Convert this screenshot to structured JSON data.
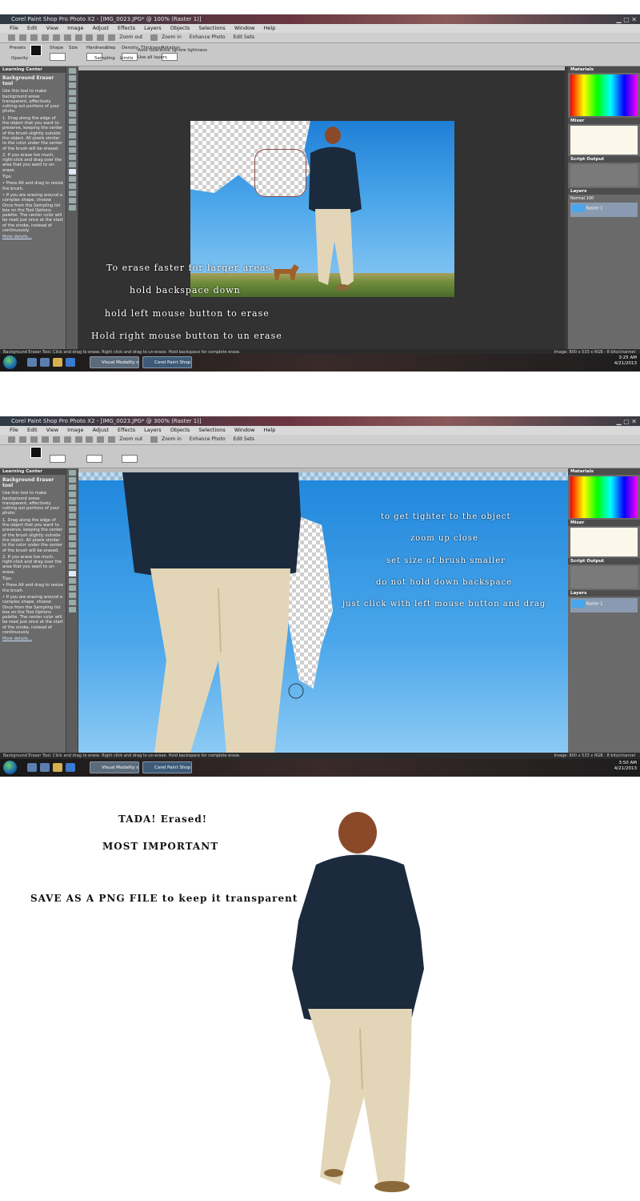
{
  "shot1": {
    "title": "Corel Paint Shop Pro Photo X2 - [IMG_0023.JPG* @ 100% (Raster 1)]",
    "menu": [
      "File",
      "Edit",
      "View",
      "Image",
      "Adjust",
      "Effects",
      "Layers",
      "Objects",
      "Selections",
      "Window",
      "Help"
    ],
    "toolbar_items": [
      "Zoom out",
      "Zoom in",
      "Enhance Photo",
      "Edit Sets"
    ],
    "tool_options": [
      "Presets",
      "Shape",
      "Size",
      "Hardness",
      "Step",
      "Density",
      "Thickness",
      "Rotation",
      "Opacity",
      "Tolerance",
      "Sharpness",
      "Sampling",
      "Limits",
      "Auto tolerance",
      "Ignore lightness",
      "Use all layers"
    ],
    "learning_center": {
      "panel_title": "Learning Center",
      "tool_title": "Background Eraser tool",
      "intro": "Use this tool to make background areas transparent, effectively cutting out portions of your photo:",
      "steps": [
        "1. Drag along the edge of the object that you want to preserve, keeping the center of the brush slightly outside the object. All pixels similar to the color under the center of the brush will be erased.",
        "2. If you erase too much, right-click and drag over the area that you want to un-erase."
      ],
      "tips_label": "Tips:",
      "tips": [
        "• Press Alt and drag to resize the brush.",
        "• If you are erasing around a complex shape, choose Once from the Sampling list box on the Tool Options palette. The center color will be read just once at the start of the stroke, instead of continuously."
      ],
      "more": "More details..."
    },
    "overlay_lines": [
      "To erase faster for larger areas",
      "hold backspace down",
      "hold left mouse button to erase",
      "Hold right mouse button to un erase"
    ],
    "right_panels": [
      "Materials",
      "Mixer",
      "Script Output",
      "Layers"
    ],
    "layer_name": "Raster 1",
    "blend_mode": "Normal",
    "opacity": "100",
    "status_left": "Background Eraser Tool: Click and drag to erase. Right click and drag to un-erase. Hold backspace for complete erase.",
    "status_right": "Image: 800 x 533 x RGB - 8 bits/channel",
    "tasks": [
      "Visual Modality on...",
      "Corel Paint Shop ..."
    ],
    "clock": "3:25 AM",
    "date": "4/21/2013"
  },
  "shot2": {
    "title": "Corel Paint Shop Pro Photo X2 - [IMG_0023.JPG* @ 300% (Raster 1)]",
    "menu": [
      "File",
      "Edit",
      "View",
      "Image",
      "Adjust",
      "Effects",
      "Layers",
      "Objects",
      "Selections",
      "Window",
      "Help"
    ],
    "toolbar_items": [
      "Zoom out",
      "Zoom in",
      "Enhance Photo",
      "Edit Sets"
    ],
    "overlay_lines": [
      "to get tighter to the object",
      "zoom up close",
      "set size of brush smaller",
      "do not hold down backspace",
      "just click with left mouse button and drag"
    ],
    "panel_title": "Learning Center",
    "tool_title": "Background Eraser tool",
    "status_left": "Background Eraser Tool: Click and drag to erase. Right click and drag to un-erase. Hold backspace for complete erase.",
    "status_right": "Image: 800 x 533 x RGB - 8 bits/channel",
    "tasks": [
      "Visual Modality on...",
      "Corel Paint Shop ..."
    ],
    "clock": "3:50 AM",
    "date": "4/21/2013"
  },
  "result": {
    "line1": "TADA! Erased!",
    "line2": "MOST IMPORTANT",
    "line3": "SAVE AS A PNG FILE to keep it transparent"
  },
  "colors": {
    "sky": "#4aa6ea",
    "hoodie": "#1b2a3d",
    "pants": "#e3d6b8",
    "grass": "#6f8d3a",
    "hair": "#8a4a2a"
  }
}
